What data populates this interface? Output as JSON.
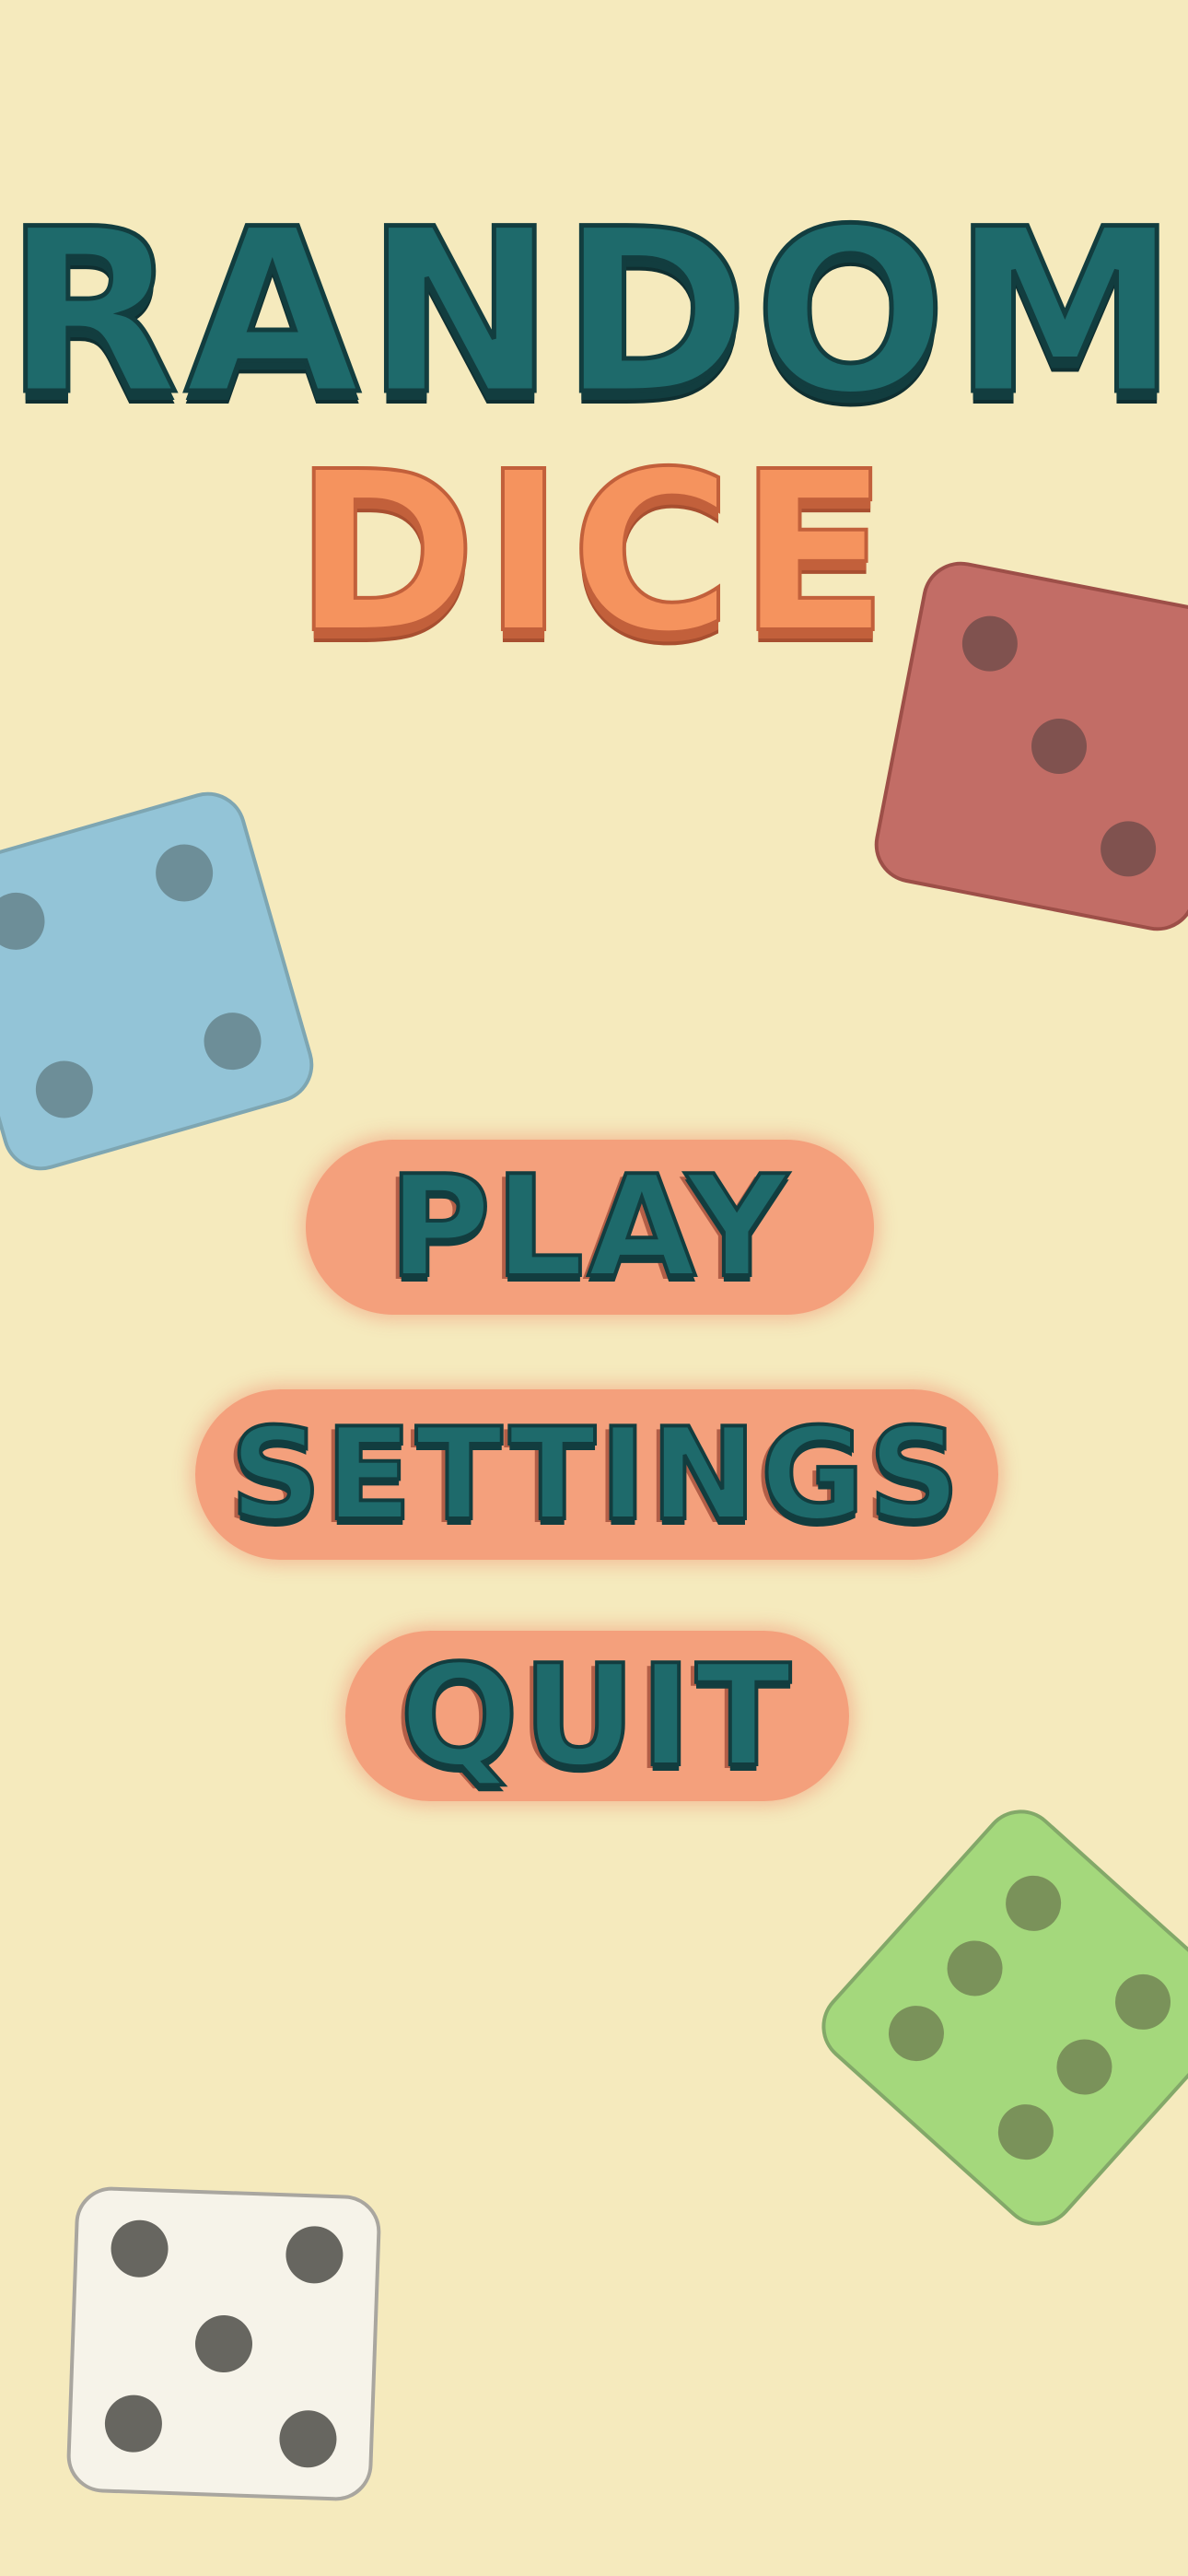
{
  "title": {
    "line1": "RANDOM",
    "line2": "DICE"
  },
  "menu": {
    "play_label": "PLAY",
    "settings_label": "SETTINGS",
    "quit_label": "QUIT"
  },
  "colors": {
    "background": "#f5eabd",
    "title_primary": "#1e6a6b",
    "title_secondary": "#f5935e",
    "button_fill": "#f4a07c",
    "die_red": "#c26d66",
    "die_blue": "#93c4d7",
    "die_green": "#a4d87c",
    "die_white": "#f6f3e9"
  },
  "decorative_dice": [
    {
      "color": "red",
      "pips": 3
    },
    {
      "color": "blue",
      "pips": 4
    },
    {
      "color": "green",
      "pips": 6
    },
    {
      "color": "white",
      "pips": 5
    }
  ]
}
